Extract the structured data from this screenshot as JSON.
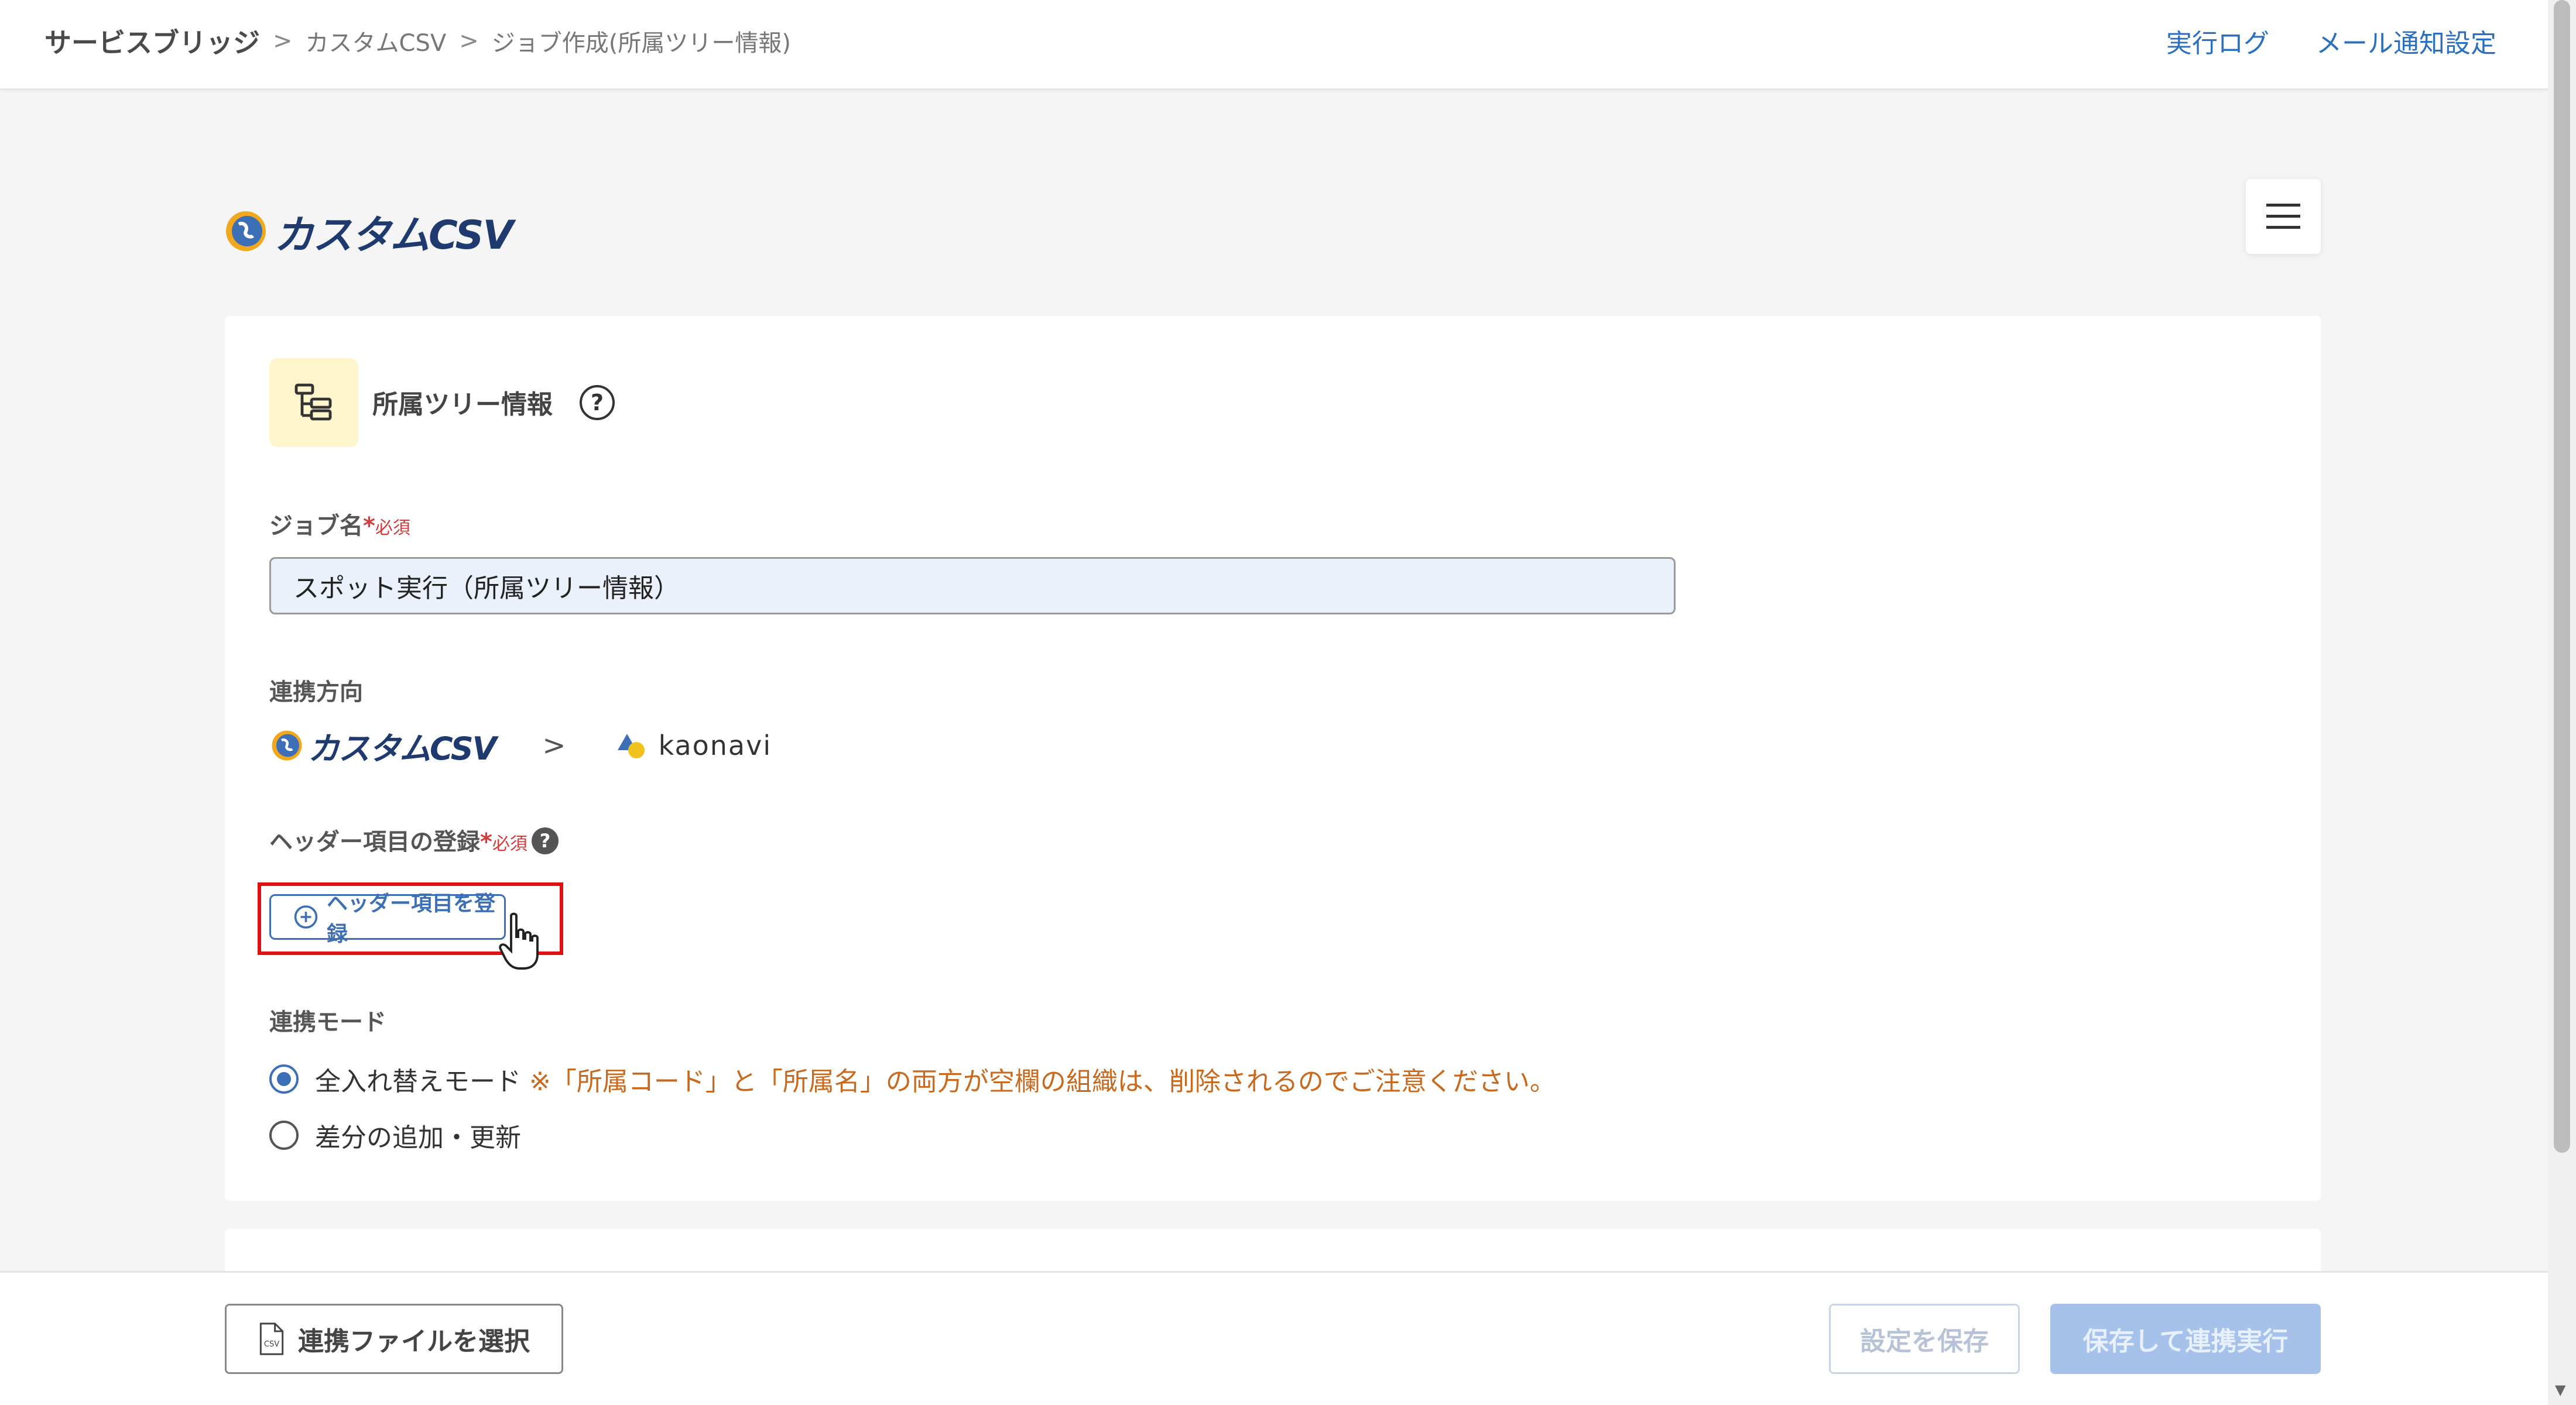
{
  "breadcrumb": {
    "root": "サービスブリッジ",
    "parent": "カスタムCSV",
    "current": "ジョブ作成(所属ツリー情報)"
  },
  "header_links": {
    "log": "実行ログ",
    "mail": "メール通知設定"
  },
  "logo": {
    "text": "カスタムCSV"
  },
  "section": {
    "title": "所属ツリー情報"
  },
  "job_name": {
    "label": "ジョブ名",
    "required": "必須",
    "value": "スポット実行（所属ツリー情報）"
  },
  "direction": {
    "label": "連携方向",
    "from": "カスタムCSV",
    "to": "kaonavi"
  },
  "header_items": {
    "label": "ヘッダー項目の登録",
    "required": "必須",
    "button": "ヘッダー項目を登録"
  },
  "mode": {
    "label": "連携モード",
    "options": [
      {
        "label": "全入れ替えモード",
        "note": "※「所属コード」と「所属名」の両方が空欄の組織は、削除されるのでご注意ください。",
        "selected": true
      },
      {
        "label": "差分の追加・更新",
        "note": "",
        "selected": false
      }
    ]
  },
  "footer": {
    "file_button": "連携ファイルを選択",
    "save_button": "設定を保存",
    "run_button": "保存して連携実行"
  },
  "colors": {
    "link": "#2b6fbf",
    "accent": "#3d6fb7",
    "warning": "#c8691d",
    "required": "#d23c3c",
    "highlight": "#e01010"
  }
}
